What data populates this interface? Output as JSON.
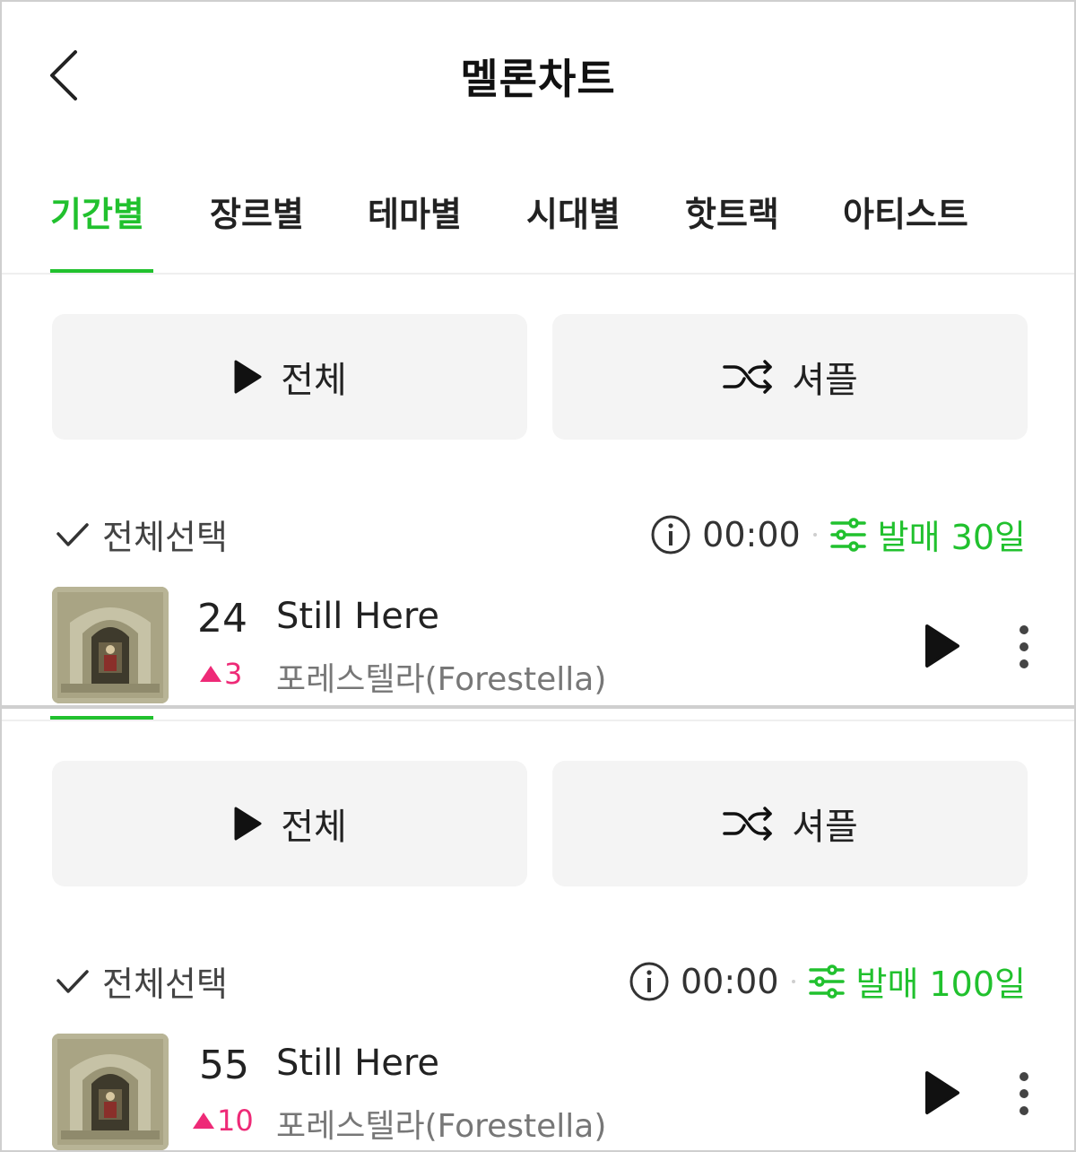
{
  "header": {
    "title": "멜론차트",
    "back_icon": "back-arrow-icon"
  },
  "tabs": [
    {
      "label": "기간별",
      "active": true
    },
    {
      "label": "장르별",
      "active": false
    },
    {
      "label": "테마별",
      "active": false
    },
    {
      "label": "시대별",
      "active": false
    },
    {
      "label": "핫트랙",
      "active": false
    },
    {
      "label": "아티스트",
      "active": false
    }
  ],
  "colors": {
    "accent": "#21c12e",
    "rank_up": "#ee2a77",
    "button_bg": "#f4f4f4"
  },
  "panels": [
    {
      "play_all_label": "전체",
      "shuffle_label": "셔플",
      "select_all_label": "전체선택",
      "time": "00:00",
      "filter_label": "발매 30일",
      "song": {
        "rank": "24",
        "rank_change": "3",
        "title": "Still Here",
        "artist": "포레스텔라(Forestella)"
      }
    },
    {
      "play_all_label": "전체",
      "shuffle_label": "셔플",
      "select_all_label": "전체선택",
      "time": "00:00",
      "filter_label": "발매 100일",
      "song": {
        "rank": "55",
        "rank_change": "10",
        "title": "Still Here",
        "artist": "포레스텔라(Forestella)"
      }
    }
  ]
}
